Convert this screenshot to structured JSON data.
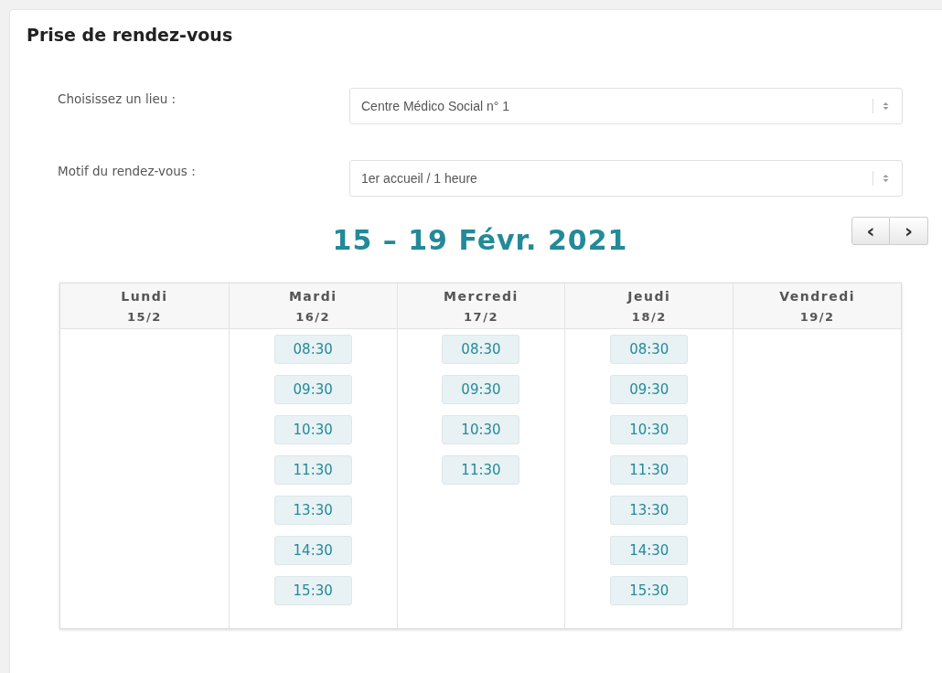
{
  "title": "Prise de rendez-vous",
  "fields": [
    {
      "label": "Choisissez un lieu :",
      "value": "Centre Médico Social n° 1"
    },
    {
      "label": "Motif du rendez-vous :",
      "value": "1er accueil / 1 heure"
    }
  ],
  "week": {
    "heading": "15 – 19 Févr. 2021",
    "prev": "‹",
    "next": "›"
  },
  "days": [
    {
      "name": "Lundi",
      "date": "15/2"
    },
    {
      "name": "Mardi",
      "date": "16/2",
      "slots": [
        "08:30",
        "09:30",
        "10:30",
        "11:30",
        "13:30",
        "14:30",
        "15:30"
      ]
    },
    {
      "name": "Mercredi",
      "date": "17/2",
      "slots": [
        "08:30",
        "09:30",
        "10:30",
        "11:30"
      ]
    },
    {
      "name": "Jeudi",
      "date": "18/2",
      "slots": [
        "08:30",
        "09:30",
        "10:30",
        "11:30",
        "13:30",
        "14:30",
        "15:30"
      ]
    },
    {
      "name": "Vendredi",
      "date": "19/2"
    }
  ]
}
